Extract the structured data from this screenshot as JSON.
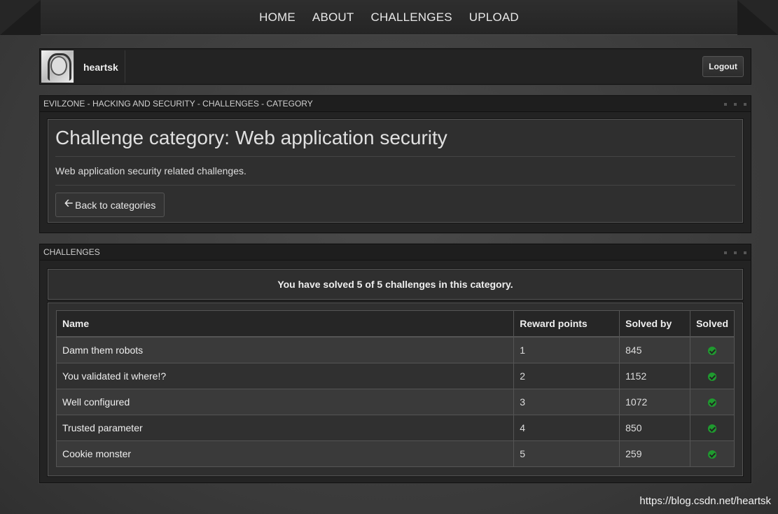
{
  "nav": {
    "items": [
      "HOME",
      "ABOUT",
      "CHALLENGES",
      "UPLOAD"
    ]
  },
  "user": {
    "name": "heartsk",
    "logout_label": "Logout"
  },
  "category_panel": {
    "header": "EVILZONE - HACKING AND SECURITY - CHALLENGES - CATEGORY",
    "title": "Challenge category: Web application security",
    "description": "Web application security related challenges.",
    "back_label": "Back to categories"
  },
  "challenges_panel": {
    "header": "CHALLENGES",
    "solved_message": "You have solved 5 of 5 challenges in this category.",
    "columns": [
      "Name",
      "Reward points",
      "Solved by",
      "Solved"
    ],
    "rows": [
      {
        "name": "Damn them robots",
        "points": "1",
        "solved_by": "845",
        "solved": true
      },
      {
        "name": "You validated it where!?",
        "points": "2",
        "solved_by": "1152",
        "solved": true
      },
      {
        "name": "Well configured",
        "points": "3",
        "solved_by": "1072",
        "solved": true
      },
      {
        "name": "Trusted parameter",
        "points": "4",
        "solved_by": "850",
        "solved": true
      },
      {
        "name": "Cookie monster",
        "points": "5",
        "solved_by": "259",
        "solved": true
      }
    ]
  },
  "colors": {
    "solved_check": "#1f9a2f"
  },
  "watermark": "https://blog.csdn.net/heartsk"
}
